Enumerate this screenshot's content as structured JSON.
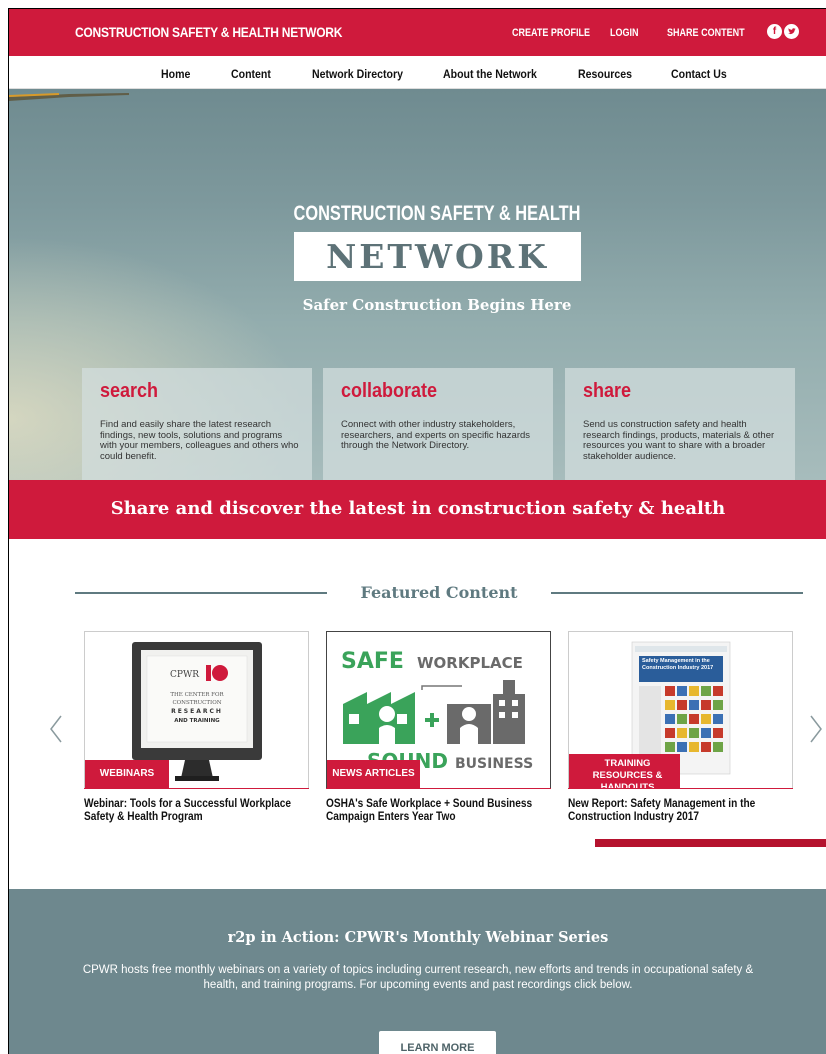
{
  "topbar": {
    "brand": "CONSTRUCTION SAFETY & HEALTH NETWORK",
    "links": [
      "CREATE PROFILE",
      "LOGIN",
      "SHARE CONTENT"
    ],
    "social": {
      "facebook": "f",
      "twitter": "t"
    }
  },
  "nav": [
    "Home",
    "Content",
    "Network Directory",
    "About the Network",
    "Resources",
    "Contact Us"
  ],
  "hero": {
    "title": "CONSTRUCTION SAFETY & HEALTH",
    "network": "NETWORK",
    "subtitle": "Safer Construction Begins Here"
  },
  "cards": [
    {
      "heading": "search",
      "text": "Find and easily share the latest research findings, new tools, solutions and programs with your members, colleagues and others who could benefit."
    },
    {
      "heading": "collaborate",
      "text": "Connect with other industry stakeholders, researchers, and experts on specific hazards through the Network Directory."
    },
    {
      "heading": "share",
      "text": "Send us construction safety and health research findings, products, materials & other resources you want to share with a broader stakeholder audience."
    }
  ],
  "banner": "Share and discover the latest in construction safety & health",
  "featured": {
    "title": "Featured Content",
    "items": [
      {
        "tag": "WEBINARS",
        "title": "Webinar: Tools for a Successful Workplace Safety & Health Program",
        "image_text": [
          "CPWR",
          "THE CENTER FOR",
          "CONSTRUCTION",
          "RESEARCH",
          "AND TRAINING"
        ]
      },
      {
        "tag": "NEWS ARTICLES",
        "title": "OSHA's Safe Workplace + Sound Business Campaign Enters Year Two",
        "image_text": [
          "SAFE",
          "WORKPLACE",
          "SOUND",
          "BUSINESS"
        ]
      },
      {
        "tag": "TRAINING RESOURCES & HANDOUTS",
        "title": "New Report: Safety Management in the Construction Industry 2017",
        "image_text": [
          "Safety Management in the Construction Industry 2017"
        ]
      }
    ]
  },
  "webinar": {
    "title": "r2p in Action: CPWR's Monthly Webinar Series",
    "text": "CPWR hosts free monthly webinars on a variety of topics including current research, new efforts and trends in occupational safety & health, and training programs. For upcoming events and past recordings click below.",
    "button": "LEARN MORE"
  },
  "colors": {
    "brand_red": "#cf1a3c",
    "slate": "#6e888e",
    "heading_gray": "#5f7a80"
  }
}
